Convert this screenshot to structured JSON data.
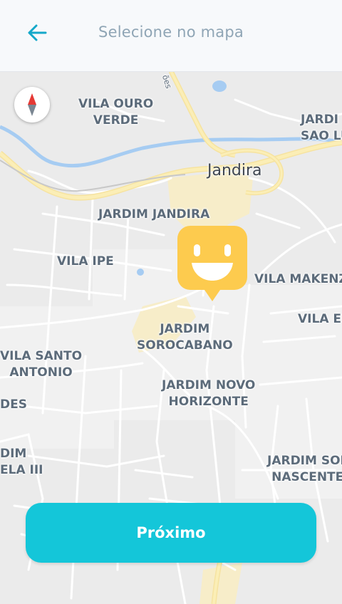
{
  "header": {
    "title": "Selecione no mapa",
    "back_icon": "arrow-left-icon",
    "accent": "#14a8c9"
  },
  "map": {
    "city": "Jandira",
    "road_label": "ões",
    "labels": {
      "vila_ouro_verde": "VILA OURO\nVERDE",
      "jardim_sao_luis": "JARDI\nSAO LU",
      "jardim_jandira": "JARDIM JANDIRA",
      "vila_ipe": "VILA IPE",
      "vila_makenzie": "VILA MAKENZ",
      "vila_eu": "VILA EU",
      "jardim_sorocabano": "JARDIM\nSOROCABANO",
      "vila_santo_antonio": "VILA SANTO\nANTONIO",
      "jardim_novo_horizonte": "JARDIM NOVO\nHORIZONTE",
      "des": "DES",
      "jardim_bela_iii": "DIM\nELA III",
      "jardim_sol_nascente": "JARDIM SOL\nNASCENTE"
    },
    "compass_icon": "compass-icon",
    "pin_icon": "smiley-pin-icon",
    "pin_color": "#fdcb4e"
  },
  "footer": {
    "next_label": "Próximo",
    "button_color": "#14c6d9"
  }
}
